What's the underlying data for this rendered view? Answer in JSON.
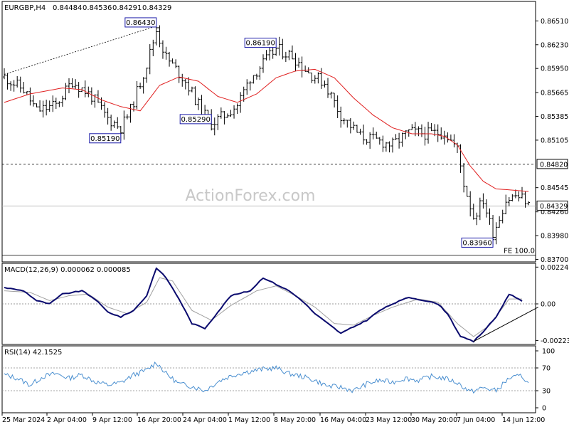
{
  "chart_data": [
    {
      "type": "candlestick",
      "symbol": "EURGBP,H4",
      "ohlc_readout": [
        "0.84484",
        "0.84536",
        "0.84291",
        "0.84329"
      ],
      "y_ticks": [
        "0.86510",
        "0.86230",
        "0.85950",
        "0.85665",
        "0.85385",
        "0.85105",
        "0.84545",
        "0.84260",
        "0.83980",
        "0.83700"
      ],
      "ylim": [
        0.8367,
        0.8674
      ],
      "x_ticks": [
        "25 Mar 2024",
        "2 Apr 04:00",
        "9 Apr 12:00",
        "16 Apr 20:00",
        "24 Apr 04:00",
        "1 May 12:00",
        "8 May 20:00",
        "16 May 04:00",
        "23 May 12:00",
        "30 May 20:00",
        "7 Jun 04:00",
        "14 Jun 12:00"
      ],
      "price_path": [
        [
          0,
          0.8585
        ],
        [
          6,
          0.857
        ],
        [
          10,
          0.8545
        ],
        [
          16,
          0.8552
        ],
        [
          21,
          0.858
        ],
        [
          27,
          0.8562
        ],
        [
          32,
          0.8536
        ],
        [
          36,
          0.8525
        ],
        [
          39,
          0.8546
        ],
        [
          44,
          0.86
        ],
        [
          47,
          0.864
        ],
        [
          50,
          0.8608
        ],
        [
          56,
          0.858
        ],
        [
          61,
          0.8545
        ],
        [
          64,
          0.853
        ],
        [
          68,
          0.854
        ],
        [
          72,
          0.8552
        ],
        [
          76,
          0.8584
        ],
        [
          81,
          0.8605
        ],
        [
          84,
          0.8618
        ],
        [
          89,
          0.861
        ],
        [
          94,
          0.859
        ],
        [
          99,
          0.8578
        ],
        [
          104,
          0.854
        ],
        [
          110,
          0.8515
        ],
        [
          115,
          0.851
        ],
        [
          120,
          0.8505
        ],
        [
          125,
          0.852
        ],
        [
          131,
          0.8518
        ],
        [
          136,
          0.852
        ],
        [
          140,
          0.85
        ],
        [
          142,
          0.846
        ],
        [
          145,
          0.842
        ],
        [
          148,
          0.844
        ],
        [
          151,
          0.84
        ],
        [
          155,
          0.844
        ],
        [
          158,
          0.8445
        ],
        [
          161,
          0.844
        ],
        [
          162,
          0.8433
        ]
      ],
      "sma_path": [
        [
          0,
          0.8555
        ],
        [
          8,
          0.8565
        ],
        [
          18,
          0.8572
        ],
        [
          24,
          0.857
        ],
        [
          30,
          0.8558
        ],
        [
          36,
          0.855
        ],
        [
          42,
          0.8545
        ],
        [
          48,
          0.8575
        ],
        [
          54,
          0.8585
        ],
        [
          60,
          0.858
        ],
        [
          66,
          0.8562
        ],
        [
          72,
          0.8555
        ],
        [
          78,
          0.8565
        ],
        [
          84,
          0.8584
        ],
        [
          90,
          0.8592
        ],
        [
          96,
          0.8594
        ],
        [
          102,
          0.8584
        ],
        [
          108,
          0.856
        ],
        [
          114,
          0.854
        ],
        [
          120,
          0.8525
        ],
        [
          126,
          0.8518
        ],
        [
          132,
          0.8518
        ],
        [
          136,
          0.8515
        ],
        [
          140,
          0.8505
        ],
        [
          144,
          0.848
        ],
        [
          148,
          0.8462
        ],
        [
          152,
          0.8453
        ],
        [
          156,
          0.8452
        ],
        [
          162,
          0.845
        ]
      ],
      "price_annotations": [
        {
          "label": "0.86430",
          "bar": 47,
          "value": 0.8643
        },
        {
          "label": "0.86190",
          "bar": 84,
          "value": 0.8619
        },
        {
          "label": "0.85290",
          "bar": 64,
          "value": 0.8529
        },
        {
          "label": "0.85190",
          "bar": 36,
          "value": 0.8519
        },
        {
          "label": "0.83960",
          "bar": 151,
          "value": 0.8396
        }
      ],
      "dashed_level": {
        "value": 0.8482,
        "label": "0.84820"
      },
      "current_level": {
        "value": 0.84329,
        "label": "0.84329"
      },
      "fe_level": {
        "value": 0.8375,
        "label": "FE 100.0"
      },
      "trendline": {
        "from": [
          0,
          0.8588
        ],
        "to": [
          47,
          0.8645
        ]
      },
      "watermark": "ActionForex.com",
      "colors": {
        "candles": "#000000",
        "sma": "#e02020",
        "label_box": "#1a1aa8"
      }
    },
    {
      "type": "line",
      "name": "MACD(12,26,9) 0.000062 0.000085",
      "y_ticks": [
        "0.002248",
        "0.00",
        "-0.002236"
      ],
      "ylim": [
        -0.00248,
        0.00248
      ],
      "macd_path": [
        [
          0,
          0.001
        ],
        [
          6,
          0.0008
        ],
        [
          10,
          0.0002
        ],
        [
          14,
          0.0
        ],
        [
          18,
          0.0006
        ],
        [
          24,
          0.0008
        ],
        [
          28,
          0.0003
        ],
        [
          32,
          -0.0005
        ],
        [
          36,
          -0.0008
        ],
        [
          40,
          -0.0004
        ],
        [
          44,
          0.0005
        ],
        [
          47,
          0.0022
        ],
        [
          50,
          0.0016
        ],
        [
          54,
          0.0003
        ],
        [
          58,
          -0.0012
        ],
        [
          62,
          -0.0015
        ],
        [
          66,
          -0.0005
        ],
        [
          70,
          0.0005
        ],
        [
          76,
          0.0008
        ],
        [
          80,
          0.0016
        ],
        [
          84,
          0.0012
        ],
        [
          88,
          0.0008
        ],
        [
          92,
          0.0002
        ],
        [
          96,
          -0.0006
        ],
        [
          100,
          -0.0012
        ],
        [
          104,
          -0.0018
        ],
        [
          108,
          -0.0014
        ],
        [
          112,
          -0.001
        ],
        [
          116,
          -0.0004
        ],
        [
          120,
          0.0
        ],
        [
          125,
          0.0004
        ],
        [
          130,
          0.0002
        ],
        [
          134,
          0.0
        ],
        [
          137,
          -0.0006
        ],
        [
          141,
          -0.002
        ],
        [
          145,
          -0.0023
        ],
        [
          148,
          -0.0017
        ],
        [
          152,
          -0.0008
        ],
        [
          156,
          0.0006
        ],
        [
          160,
          0.0002
        ]
      ],
      "signal_path": [
        [
          0,
          0.0008
        ],
        [
          8,
          0.0007
        ],
        [
          14,
          0.0002
        ],
        [
          20,
          0.0005
        ],
        [
          26,
          0.0006
        ],
        [
          32,
          -0.0002
        ],
        [
          38,
          -0.0006
        ],
        [
          44,
          0.0001
        ],
        [
          48,
          0.0016
        ],
        [
          52,
          0.0014
        ],
        [
          58,
          -0.0004
        ],
        [
          64,
          -0.001
        ],
        [
          70,
          -0.0001
        ],
        [
          78,
          0.0008
        ],
        [
          84,
          0.0011
        ],
        [
          90,
          0.0005
        ],
        [
          96,
          -0.0002
        ],
        [
          102,
          -0.0012
        ],
        [
          108,
          -0.0013
        ],
        [
          114,
          -0.0007
        ],
        [
          120,
          -0.0002
        ],
        [
          128,
          0.0003
        ],
        [
          134,
          0.0001
        ],
        [
          140,
          -0.0012
        ],
        [
          145,
          -0.002
        ],
        [
          150,
          -0.0013
        ],
        [
          156,
          0.0003
        ],
        [
          160,
          0.0003
        ]
      ],
      "trendline": {
        "from": [
          145,
          -0.0023
        ],
        "to": [
          165,
          -0.0002
        ]
      },
      "colors": {
        "macd": "#0a0a6e",
        "signal": "#a0a0a0"
      }
    },
    {
      "type": "line",
      "name": "RSI(14) 42.1525",
      "y_ticks": [
        "100",
        "70",
        "30",
        "0"
      ],
      "ylim": [
        0,
        100
      ],
      "rsi_path": [
        [
          0,
          58
        ],
        [
          4,
          52
        ],
        [
          8,
          40
        ],
        [
          12,
          55
        ],
        [
          16,
          60
        ],
        [
          20,
          52
        ],
        [
          24,
          58
        ],
        [
          28,
          46
        ],
        [
          32,
          40
        ],
        [
          36,
          44
        ],
        [
          40,
          58
        ],
        [
          44,
          66
        ],
        [
          47,
          80
        ],
        [
          50,
          60
        ],
        [
          54,
          42
        ],
        [
          58,
          38
        ],
        [
          62,
          30
        ],
        [
          66,
          46
        ],
        [
          70,
          56
        ],
        [
          74,
          62
        ],
        [
          80,
          68
        ],
        [
          84,
          70
        ],
        [
          88,
          60
        ],
        [
          92,
          55
        ],
        [
          96,
          48
        ],
        [
          100,
          38
        ],
        [
          104,
          36
        ],
        [
          108,
          30
        ],
        [
          112,
          42
        ],
        [
          116,
          48
        ],
        [
          120,
          45
        ],
        [
          124,
          52
        ],
        [
          128,
          48
        ],
        [
          132,
          55
        ],
        [
          136,
          52
        ],
        [
          140,
          44
        ],
        [
          144,
          28
        ],
        [
          148,
          35
        ],
        [
          152,
          30
        ],
        [
          156,
          52
        ],
        [
          160,
          56
        ],
        [
          162,
          42
        ]
      ],
      "colors": {
        "rsi": "#4a8fd0"
      }
    }
  ]
}
